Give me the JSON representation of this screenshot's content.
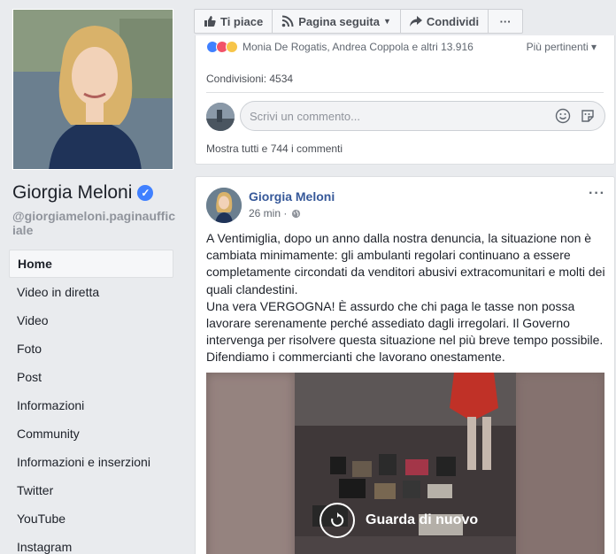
{
  "profile": {
    "name": "Giorgia Meloni",
    "username": "@giorgiameloni.paginaufficiale"
  },
  "nav": {
    "items": [
      {
        "label": "Home",
        "active": true
      },
      {
        "label": "Video in diretta"
      },
      {
        "label": "Video"
      },
      {
        "label": "Foto"
      },
      {
        "label": "Post"
      },
      {
        "label": "Informazioni"
      },
      {
        "label": "Community"
      },
      {
        "label": "Informazioni e inserzioni"
      },
      {
        "label": "Twitter"
      },
      {
        "label": "YouTube"
      },
      {
        "label": "Instagram"
      }
    ]
  },
  "actionbar": {
    "like": "Ti piace",
    "followed": "Pagina seguita",
    "share": "Condividi",
    "more": "···"
  },
  "prev_post": {
    "reactions_text": "Monia De Rogatis, Andrea Coppola e altri 13.916",
    "sort_label": "Più pertinenti ▾",
    "shares": "Condivisioni: 4534",
    "comment_placeholder": "Scrivi un commento...",
    "all_comments": "Mostra tutti e 744 i commenti"
  },
  "post": {
    "author": "Giorgia Meloni",
    "time": "26 min ·",
    "paragraph1": "A Ventimiglia, dopo un anno dalla nostra denuncia, la situazione non è cambiata minimamente: gli ambulanti regolari continuano a essere completamente circondati da venditori abusivi extracomunitari e molti dei quali clandestini.",
    "paragraph2": "Una vera VERGOGNA! È assurdo che chi paga le tasse non possa lavorare serenamente perché assediato dagli irregolari. Il Governo intervenga per risolvere questa situazione nel più breve tempo possibile. Difendiamo i commercianti che lavorano onestamente.",
    "replay_label": "Guarda di nuovo"
  },
  "colors": {
    "link": "#365899",
    "accent": "#4080ff",
    "background": "#e9ebee"
  }
}
